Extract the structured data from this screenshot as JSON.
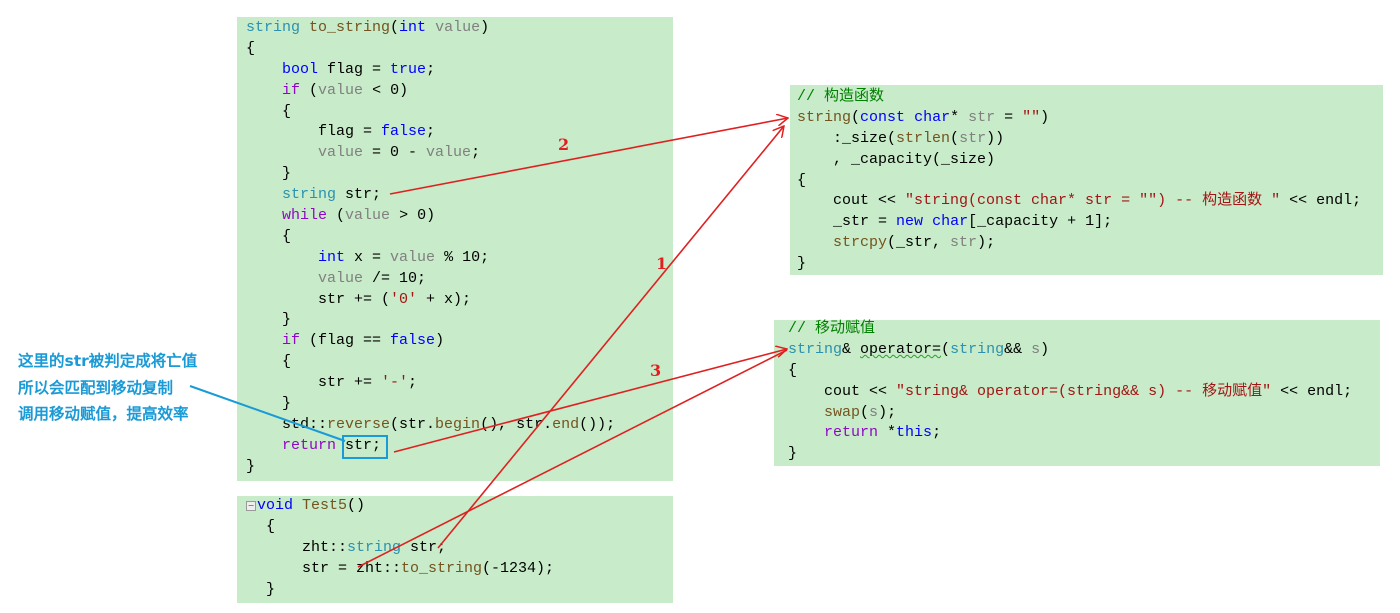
{
  "note": {
    "lines": [
      "这里的str被判定成将亡值",
      "所以会匹配到移动复制",
      "调用移动赋值，提高效率"
    ],
    "color": "#1a9ad6"
  },
  "arrow_labels": [
    "1",
    "2",
    "3"
  ],
  "colors": {
    "code_bg": "#c8ebc9",
    "arrow": "#e02020",
    "highlight": "#1a9ad6"
  },
  "blocks": {
    "to_string": [
      [
        [
          "string",
          "type"
        ],
        [
          " to_string",
          "fn"
        ],
        [
          "(",
          "op"
        ],
        [
          "int",
          "kw"
        ],
        [
          " value",
          "par"
        ],
        [
          ")",
          "op"
        ]
      ],
      [
        [
          "{",
          "op"
        ]
      ],
      [
        [
          "    ",
          "op"
        ],
        [
          "bool",
          "kw"
        ],
        [
          " flag = ",
          "op"
        ],
        [
          "true",
          "kw"
        ],
        [
          ";",
          "op"
        ]
      ],
      [
        [
          "    ",
          "op"
        ],
        [
          "if",
          "ctl"
        ],
        [
          " (",
          "op"
        ],
        [
          "value",
          "par"
        ],
        [
          " < 0)",
          "op"
        ]
      ],
      [
        [
          "    {",
          "op"
        ]
      ],
      [
        [
          "        flag = ",
          "op"
        ],
        [
          "false",
          "kw"
        ],
        [
          ";",
          "op"
        ]
      ],
      [
        [
          "        ",
          "op"
        ],
        [
          "value",
          "par"
        ],
        [
          " = 0 - ",
          "op"
        ],
        [
          "value",
          "par"
        ],
        [
          ";",
          "op"
        ]
      ],
      [
        [
          "    }",
          "op"
        ]
      ],
      [
        [
          "    ",
          "op"
        ],
        [
          "string",
          "type"
        ],
        [
          " str;",
          "op"
        ]
      ],
      [
        [
          "    ",
          "op"
        ],
        [
          "while",
          "ctl"
        ],
        [
          " (",
          "op"
        ],
        [
          "value",
          "par"
        ],
        [
          " > 0)",
          "op"
        ]
      ],
      [
        [
          "    {",
          "op"
        ]
      ],
      [
        [
          "        ",
          "op"
        ],
        [
          "int",
          "kw"
        ],
        [
          " x = ",
          "op"
        ],
        [
          "value",
          "par"
        ],
        [
          " % 10;",
          "op"
        ]
      ],
      [
        [
          "        ",
          "op"
        ],
        [
          "value",
          "par"
        ],
        [
          " /= 10;",
          "op"
        ]
      ],
      [
        [
          "        str += (",
          "op"
        ],
        [
          "'0'",
          "str"
        ],
        [
          " + x);",
          "op"
        ]
      ],
      [
        [
          "    }",
          "op"
        ]
      ],
      [
        [
          "    ",
          "op"
        ],
        [
          "if",
          "ctl"
        ],
        [
          " (flag == ",
          "op"
        ],
        [
          "false",
          "kw"
        ],
        [
          ")",
          "op"
        ]
      ],
      [
        [
          "    {",
          "op"
        ]
      ],
      [
        [
          "        str += ",
          "op"
        ],
        [
          "'-'",
          "str"
        ],
        [
          ";",
          "op"
        ]
      ],
      [
        [
          "    }",
          "op"
        ]
      ],
      [
        [
          "    std::",
          "op"
        ],
        [
          "reverse",
          "fn"
        ],
        [
          "(str.",
          "op"
        ],
        [
          "begin",
          "fn"
        ],
        [
          "(), str.",
          "op"
        ],
        [
          "end",
          "fn"
        ],
        [
          "());",
          "op"
        ]
      ],
      [
        [
          "    ",
          "op"
        ],
        [
          "return",
          "ctl"
        ],
        [
          " str;",
          "op"
        ]
      ],
      [
        [
          "}",
          "op"
        ]
      ]
    ],
    "test5": [
      [
        [
          "void",
          "kw"
        ],
        [
          " Test5",
          "fn"
        ],
        [
          "()",
          "op"
        ]
      ],
      [
        [
          " {",
          "op"
        ]
      ],
      [
        [
          "     zht::",
          "op"
        ],
        [
          "string",
          "type"
        ],
        [
          " str;",
          "op"
        ]
      ],
      [
        [
          "     str = zht::",
          "op"
        ],
        [
          "to_string",
          "fn"
        ],
        [
          "(-1234);",
          "op"
        ]
      ],
      [
        [
          " }",
          "op"
        ]
      ]
    ],
    "constructor": [
      [
        [
          "// 构造函数",
          "cmt"
        ]
      ],
      [
        [
          "string",
          "fn"
        ],
        [
          "(",
          "op"
        ],
        [
          "const",
          "kw"
        ],
        [
          " ",
          "op"
        ],
        [
          "char",
          "kw"
        ],
        [
          "* ",
          "op"
        ],
        [
          "str",
          "par"
        ],
        [
          " = ",
          "op"
        ],
        [
          "\"\"",
          "str"
        ],
        [
          ")",
          "op"
        ]
      ],
      [
        [
          "    :_size(",
          "op"
        ],
        [
          "strlen",
          "fn"
        ],
        [
          "(",
          "op"
        ],
        [
          "str",
          "par"
        ],
        [
          "))",
          "op"
        ]
      ],
      [
        [
          "    , _capacity(_size)",
          "op"
        ]
      ],
      [
        [
          "{",
          "op"
        ]
      ],
      [
        [
          "    cout << ",
          "op"
        ],
        [
          "\"string(const char* str = \"\") -- 构造函数 \"",
          "str"
        ],
        [
          " << endl;",
          "op"
        ]
      ],
      [
        [
          "    _str = ",
          "op"
        ],
        [
          "new",
          "kw"
        ],
        [
          " ",
          "op"
        ],
        [
          "char",
          "kw"
        ],
        [
          "[_capacity + 1];",
          "op"
        ]
      ],
      [
        [
          "    ",
          "op"
        ],
        [
          "strcpy",
          "fn"
        ],
        [
          "(_str, ",
          "op"
        ],
        [
          "str",
          "par"
        ],
        [
          ");",
          "op"
        ]
      ],
      [
        [
          "}",
          "op"
        ]
      ]
    ],
    "move_assign": [
      [
        [
          "// 移动赋值",
          "cmt"
        ]
      ],
      [
        [
          "string",
          "type"
        ],
        [
          "& ",
          "op"
        ],
        [
          "operator=",
          "squig"
        ],
        [
          "(",
          "op"
        ],
        [
          "string",
          "type"
        ],
        [
          "&& ",
          "op"
        ],
        [
          "s",
          "par"
        ],
        [
          ")",
          "op"
        ]
      ],
      [
        [
          "{",
          "op"
        ]
      ],
      [
        [
          "    cout << ",
          "op"
        ],
        [
          "\"string& operator=(string&& s) -- 移动赋值\"",
          "str"
        ],
        [
          " << endl;",
          "op"
        ]
      ],
      [
        [
          "    ",
          "op"
        ],
        [
          "swap",
          "fn"
        ],
        [
          "(",
          "op"
        ],
        [
          "s",
          "par"
        ],
        [
          ");",
          "op"
        ]
      ],
      [
        [
          "    ",
          "op"
        ],
        [
          "return",
          "ctl"
        ],
        [
          " *",
          "op"
        ],
        [
          "this",
          "kw"
        ],
        [
          ";",
          "op"
        ]
      ],
      [
        [
          "}",
          "op"
        ]
      ]
    ]
  }
}
